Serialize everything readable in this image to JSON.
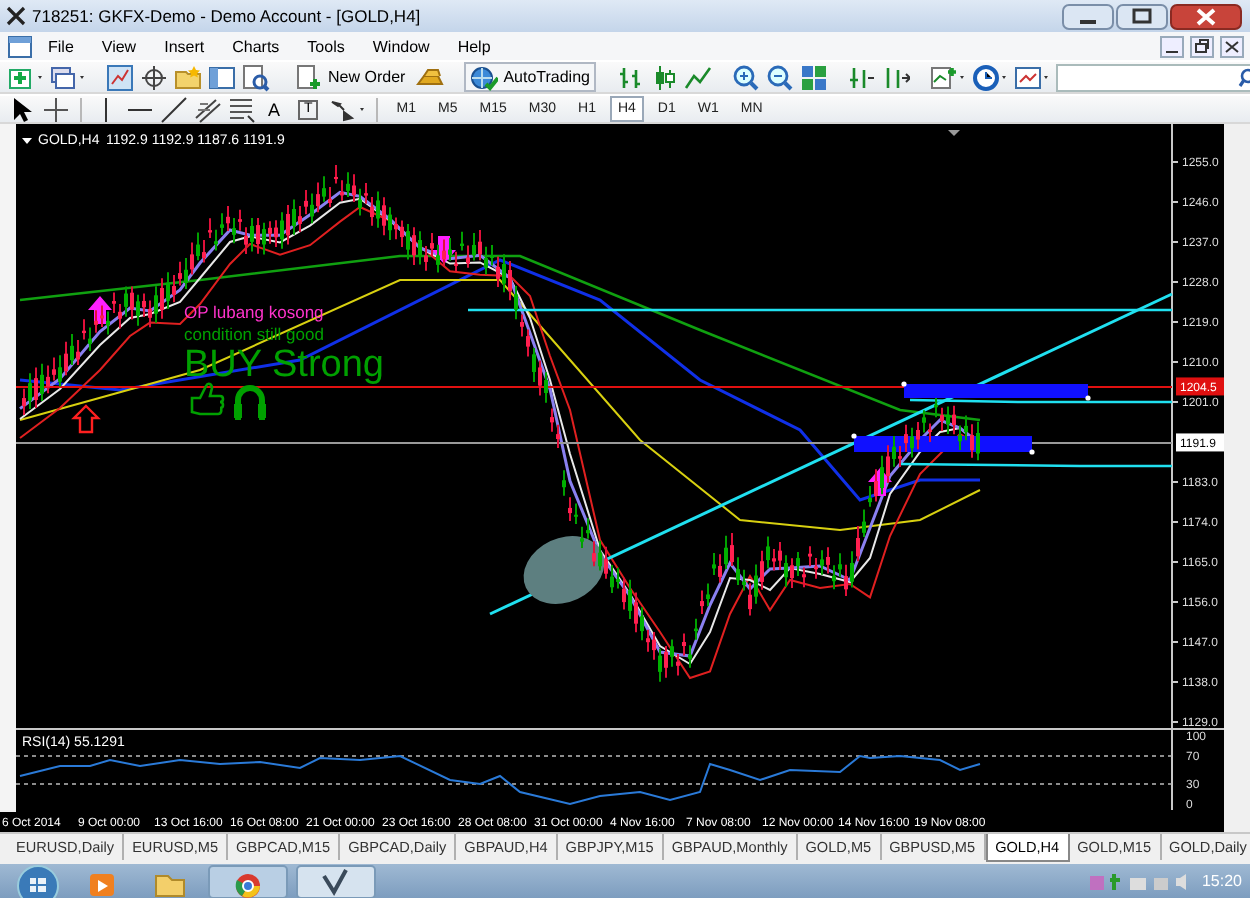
{
  "window": {
    "title": "718251: GKFX-Demo - Demo Account - [GOLD,H4]"
  },
  "menu": [
    "File",
    "View",
    "Insert",
    "Charts",
    "Tools",
    "Window",
    "Help"
  ],
  "toolbar": {
    "new_order": "New Order",
    "autotrading": "AutoTrading"
  },
  "drawing_tools": {
    "text_tool": "A",
    "label_tool": "T"
  },
  "periods": [
    {
      "label": "M1",
      "selected": false
    },
    {
      "label": "M5",
      "selected": false
    },
    {
      "label": "M15",
      "selected": false
    },
    {
      "label": "M30",
      "selected": false
    },
    {
      "label": "H1",
      "selected": false
    },
    {
      "label": "H4",
      "selected": true
    },
    {
      "label": "D1",
      "selected": false
    },
    {
      "label": "W1",
      "selected": false
    },
    {
      "label": "MN",
      "selected": false
    }
  ],
  "chart": {
    "symbol": "GOLD,H4",
    "quote": "1192.9 1192.9 1187.6 1191.9",
    "signals": [
      {
        "kind": "note",
        "text": "OP lubang kosong",
        "color": "#ff33cc"
      },
      {
        "kind": "note",
        "text": "condition still good",
        "color": "#00a000"
      },
      {
        "kind": "headline",
        "text": "BUY Strong",
        "color": "#00a000"
      }
    ],
    "price_axis": [
      "1255.0",
      "1246.0",
      "1237.0",
      "1228.0",
      "1219.0",
      "1210.0",
      "1201.0",
      "1183.0",
      "1174.0",
      "1165.0",
      "1156.0",
      "1147.0",
      "1138.0",
      "1129.0"
    ],
    "price_labels": [
      {
        "kind": "line",
        "text": "1204.5"
      },
      {
        "kind": "bid",
        "text": "1191.9"
      }
    ]
  },
  "rsi": {
    "label": "RSI(14) 55.1291",
    "axis": [
      "100",
      "70",
      "30",
      "0"
    ]
  },
  "time_axis": [
    "6 Oct 2014",
    "9 Oct 00:00",
    "13 Oct 16:00",
    "16 Oct 08:00",
    "21 Oct 00:00",
    "23 Oct 16:00",
    "28 Oct 08:00",
    "31 Oct 00:00",
    "4 Nov 16:00",
    "7 Nov 08:00",
    "12 Nov 00:00",
    "14 Nov 16:00",
    "19 Nov 08:00"
  ],
  "tabs": [
    {
      "label": "EURUSD,Daily",
      "selected": false
    },
    {
      "label": "EURUSD,M5",
      "selected": false
    },
    {
      "label": "GBPCAD,M15",
      "selected": false
    },
    {
      "label": "GBPCAD,Daily",
      "selected": false
    },
    {
      "label": "GBPAUD,H4",
      "selected": false
    },
    {
      "label": "GBPJPY,M15",
      "selected": false
    },
    {
      "label": "GBPAUD,Monthly",
      "selected": false
    },
    {
      "label": "GOLD,M5",
      "selected": false
    },
    {
      "label": "GBPUSD,M5",
      "selected": false
    },
    {
      "label": "GOLD,H4",
      "selected": true
    },
    {
      "label": "GOLD,M15",
      "selected": false
    },
    {
      "label": "GOLD,Daily",
      "selected": false
    }
  ],
  "taskbar": {
    "clock": "15:20"
  }
}
